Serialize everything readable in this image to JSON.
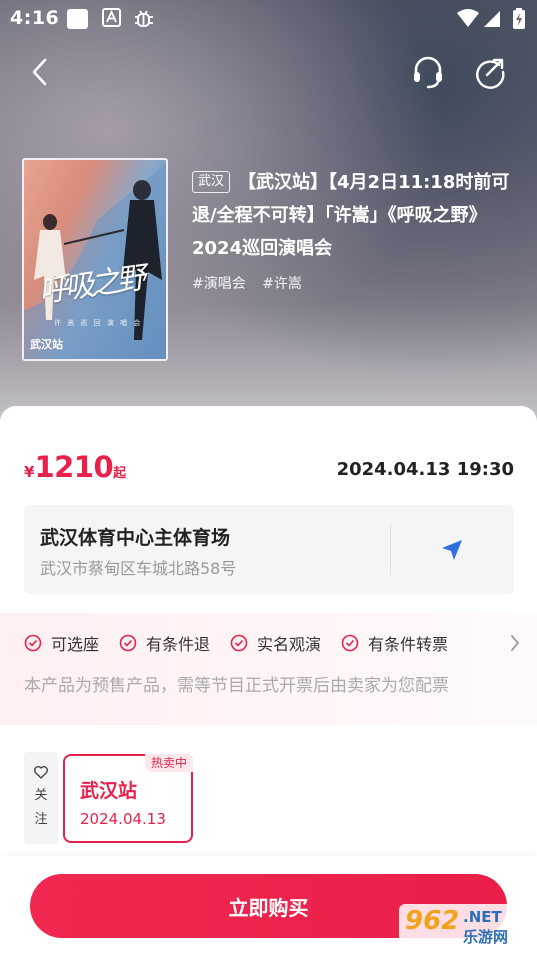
{
  "status_bar": {
    "time": "4:16",
    "icons": [
      "app-square-icon",
      "text-app-icon",
      "bug-icon",
      "wifi-icon",
      "signal-icon",
      "battery-charging-icon"
    ]
  },
  "nav": {
    "back_icon": "back-chevron-icon",
    "service_icon": "headset-icon",
    "share_icon": "share-icon"
  },
  "event": {
    "city_tag": "武汉",
    "title": "【武汉站】【4月2日11:18时前可退/全程不可转】「许嵩」《呼吸之野》2024巡回演唱会",
    "tags": [
      "#演唱会",
      "#许嵩"
    ],
    "poster": {
      "title": "呼吸之野",
      "subtitle": "许 嵩 巡 回 演 唱 会",
      "city": "武汉站"
    }
  },
  "price": {
    "currency": "¥",
    "amount": "1210",
    "suffix": "起"
  },
  "show_datetime": "2024.04.13 19:30",
  "venue": {
    "name": "武汉体育中心主体育场",
    "address": "武汉市蔡甸区车城北路58号",
    "nav_icon": "navigation-arrow-icon"
  },
  "policies": {
    "items": [
      "可选座",
      "有条件退",
      "实名观演",
      "有条件转票"
    ],
    "note": "本产品为预售产品，需等节目正式开票后由卖家为您配票"
  },
  "follow": {
    "label_1": "关",
    "label_2": "注"
  },
  "session": {
    "badge": "热卖中",
    "name": "武汉站",
    "date": "2024.04.13"
  },
  "buy_button": "立即购买",
  "watermark": {
    "number": "962",
    "net": ".NET",
    "cn": "乐游网"
  },
  "colors": {
    "accent": "#e8214a",
    "venue_nav": "#2f6fe0"
  }
}
